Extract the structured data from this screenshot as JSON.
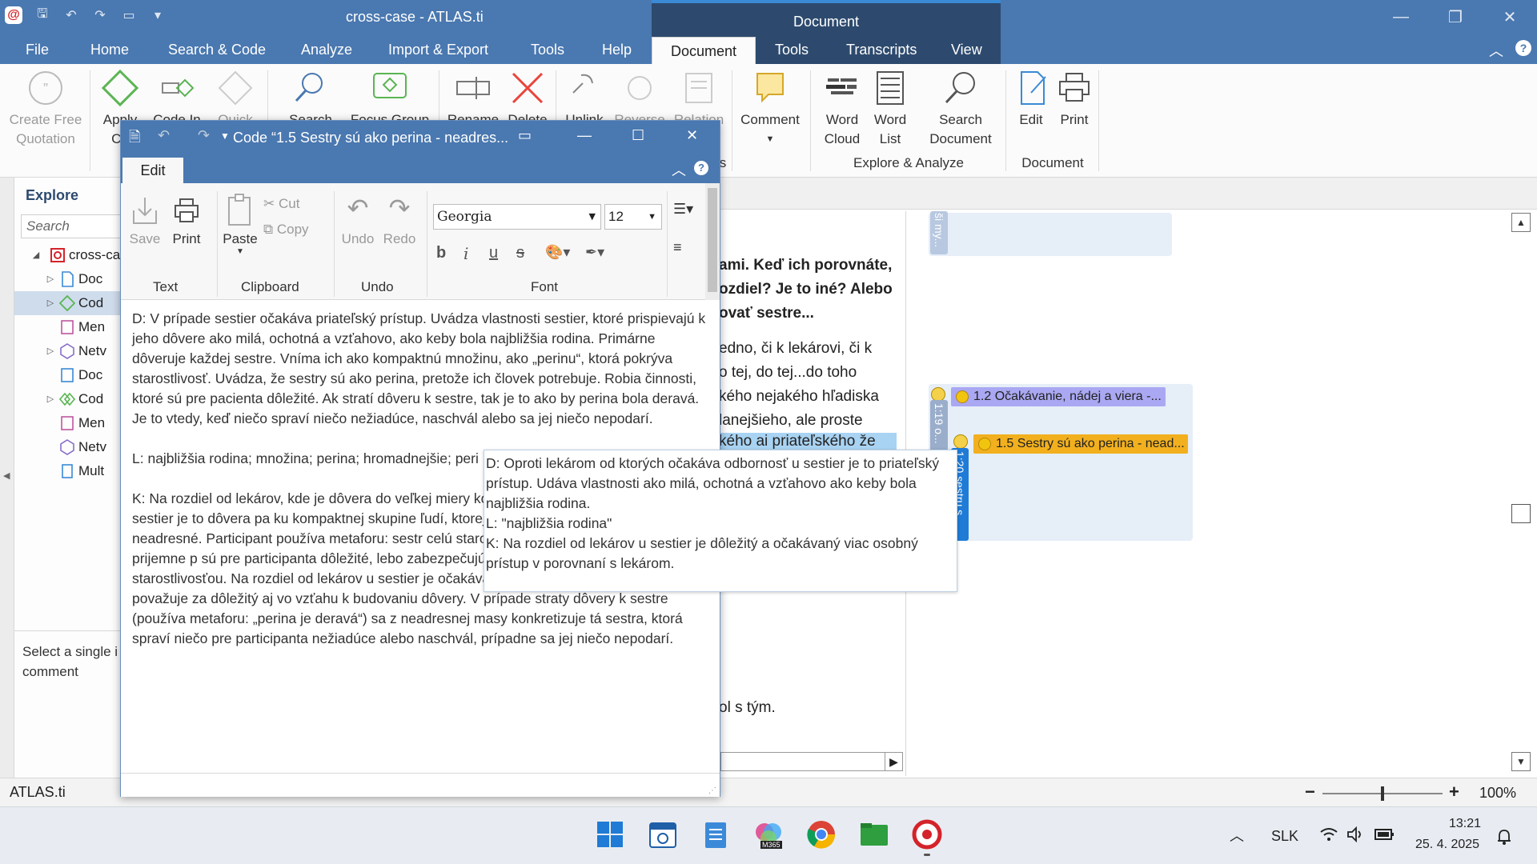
{
  "window": {
    "title": "cross-case - ATLAS.ti",
    "context_tab_header": "Document"
  },
  "tabs": {
    "file": "File",
    "home": "Home",
    "search_code": "Search & Code",
    "analyze": "Analyze",
    "import_export": "Import & Export",
    "tools": "Tools",
    "help": "Help",
    "document": "Document",
    "tools2": "Tools",
    "transcripts": "Transcripts",
    "view": "View"
  },
  "ribbon": {
    "create_free_quotation": [
      "Create Free",
      "Quotation"
    ],
    "apply": "Apply",
    "apply2": "Co",
    "code_in": "Code In",
    "quick": "Quick",
    "search": "Search",
    "focus_group": "Focus Group",
    "rename": "Rename",
    "delete": "Delete",
    "unlink": "Unlink",
    "reverse": "Reverse",
    "relation": "Relation",
    "comment": "Comment",
    "comment_group_tail": "s",
    "word_cloud": [
      "Word",
      "Cloud"
    ],
    "word_list": [
      "Word",
      "List"
    ],
    "search_document": [
      "Search",
      "Document"
    ],
    "explore_analyze": "Explore & Analyze",
    "edit": "Edit",
    "print": "Print",
    "document_group": "Document"
  },
  "explore": {
    "title": "Explore",
    "search_placeholder": "Search",
    "items": [
      {
        "label": "cross-ca"
      },
      {
        "label": "Doc"
      },
      {
        "label": "Cod"
      },
      {
        "label": "Men"
      },
      {
        "label": "Netv"
      },
      {
        "label": "Doc"
      },
      {
        "label": "Cod"
      },
      {
        "label": "Men"
      },
      {
        "label": "Netv"
      },
      {
        "label": "Mult"
      }
    ],
    "note": "Select a single i comment"
  },
  "document_text": {
    "line1": "ami. Keď ich porovnáte,",
    "line2": "ozdiel? Je to iné? Alebo",
    "line3": "ovať sestre...",
    "line4": "edno, či k lekárovi, či k",
    "line5": "o tej, do tej...do toho",
    "line6": "kého nejakého hľadiska",
    "line7": "lanejšieho, ale proste",
    "line8": "kého ai priateľského  že",
    "line9": "ol s tým."
  },
  "margin": {
    "q0_label": "ši my...",
    "q1_label": "1:19 o...",
    "q1_code": "1.2 Očakávanie, nádej a viera -...",
    "q2_label": "1:20 sestru s...",
    "q2_code": "1.5 Sestry sú ako perina - nead..."
  },
  "code_window": {
    "title": "Code “1.5 Sestry sú ako perina - neadres...",
    "tab": "Edit",
    "save": "Save",
    "print": "Print",
    "text_group": "Text",
    "paste": "Paste",
    "cut": "Cut",
    "copy": "Copy",
    "clipboard_group": "Clipboard",
    "undo": "Undo",
    "redo": "Redo",
    "undo_group": "Undo",
    "font_name": "Georgia",
    "font_size": "12",
    "font_group": "Font",
    "bold": "b",
    "italic": "i",
    "underline": "u",
    "strike": "s",
    "para1": "D: V prípade sestier očakáva priateľský prístup. Uvádza vlastnosti sestier, ktoré prispievajú k jeho dôvere ako milá, ochotná a vzťahovo, ako keby bola najbližšia rodina. Primárne dôveruje každej sestre. Vníma ich ako kompaktnú množinu, ako „perinu“, ktorá pokrýva starostlivosť. Uvádza, že sestry sú ako perina, pretože ich človek potrebuje. Robia činnosti, ktoré sú pre pacienta dôležité. Ak stratí dôveru k sestre, tak je to ako by perina bola deravá. Je to vtedy, keď niečo spraví niečo nežiadúce, naschvál alebo sa jej niečo nepodarí.",
    "para2": "L: najbližšia rodina; množina; perina; hromadnejšie; peri",
    "para3": "K: Na rozdiel od lekárov, kde je dôvera do veľkej miery konkrétnemu lekárovi), v prípade sestier je to dôvera pa ku kompaktnej skupine ľudí, ktorej však primárne dôve v dôvere neadresné. Participant používa metaforu: sestr celú starostlivosť. Metafora „periny“ evokuje prijemne p sú pre participanta dôležité, lebo zabezpečujú každodenné činnosti súvisiace so starostlivosťou.  Na rozdiel od lekárov u sestier je očakávaný viac osobný prístup, ktorý považuje za dôležitý aj vo vzťahu k budovaniu dôvery. V prípade straty dôvery k sestre (používa metaforu: „perina je deravá“) sa z neadresnej masy konkretizuje tá sestra, ktorá spraví niečo pre participanta nežiadúce alebo naschvál, prípadne sa jej niečo nepodarí."
  },
  "tooltip": {
    "line1": "D: Oproti lekárom od ktorých očakáva odbornosť u sestier je to priateľský prístup. Udáva vlastnosti ako milá, ochotná a vzťahovo ako keby bola najbližšia rodina.",
    "line2": "L: \"najbližšia rodina\"",
    "line3": "K: Na rozdiel od lekárov u sestier je dôležitý a očakávaný viac osobný prístup v porovnaní s lekárom."
  },
  "statusbar": {
    "app": "ATLAS.ti",
    "zoom": "100%",
    "zoom_fraction": 0.5
  },
  "taskbar": {
    "lang": "SLK",
    "time": "13:21",
    "date": "25. 4. 2025",
    "m365": "M365"
  },
  "colors": {
    "titlebar": "#4a78b0",
    "context": "#2d4a6e",
    "code_yellow": "#f2b01e",
    "code_purple": "#a9a6f2",
    "quote_blue": "#1f7bd6"
  }
}
